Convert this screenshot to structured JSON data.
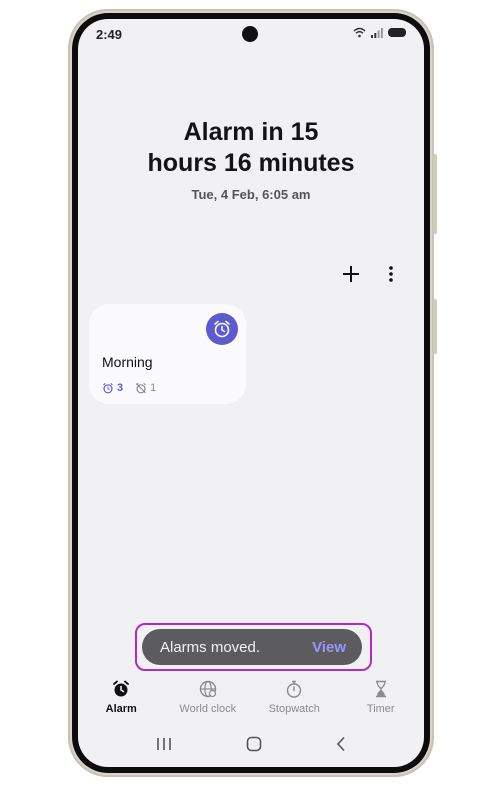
{
  "status_bar": {
    "time": "2:49"
  },
  "hero": {
    "title_line1": "Alarm in 15",
    "title_line2": "hours 16 minutes",
    "subtitle": "Tue, 4 Feb, 6:05 am"
  },
  "toolbar": {
    "add_icon": "plus-icon",
    "more_icon": "more-vertical-icon"
  },
  "alarm_card": {
    "name": "Morning",
    "enabled_count": "3",
    "disabled_count": "1",
    "accent_color": "#5e5ad1"
  },
  "toast": {
    "message": "Alarms moved.",
    "action": "View",
    "action_color": "#9d93ff",
    "highlight_color": "#b02ac6"
  },
  "bottom_nav": {
    "tabs": [
      {
        "label": "Alarm",
        "icon": "alarm-clock-icon",
        "active": true
      },
      {
        "label": "World clock",
        "icon": "globe-icon",
        "active": false
      },
      {
        "label": "Stopwatch",
        "icon": "stopwatch-icon",
        "active": false
      },
      {
        "label": "Timer",
        "icon": "hourglass-icon",
        "active": false
      }
    ]
  },
  "system_nav": [
    "recents-icon",
    "home-icon",
    "back-icon"
  ]
}
